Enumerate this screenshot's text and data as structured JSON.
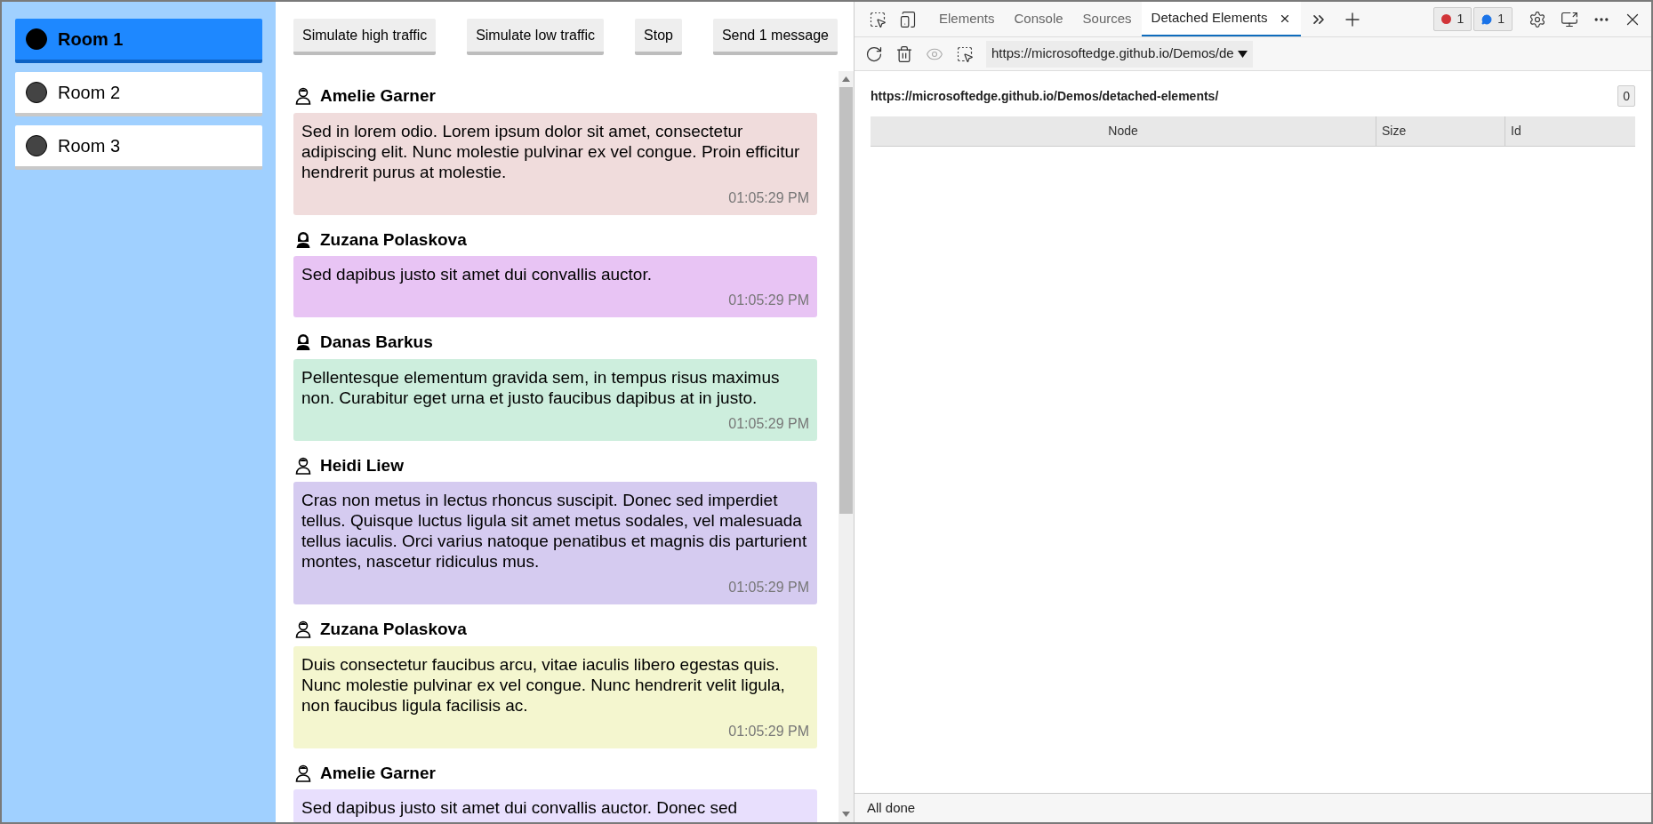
{
  "rooms": [
    {
      "label": "Room 1",
      "selected": true
    },
    {
      "label": "Room 2",
      "selected": false
    },
    {
      "label": "Room 3",
      "selected": false
    }
  ],
  "chat_buttons": [
    "Simulate high traffic",
    "Simulate low traffic",
    "Stop",
    "Send 1 message"
  ],
  "messages": [
    {
      "author": "Amelie Garner",
      "kind": "short-hair",
      "color": "#f0dcdc",
      "text": "Sed in lorem odio. Lorem ipsum dolor sit amet, consectetur adipiscing elit. Nunc molestie pulvinar ex vel congue. Proin efficitur hendrerit purus at molestie.",
      "time": "01:05:29 PM"
    },
    {
      "author": "Zuzana Polaskova",
      "kind": "long-hair",
      "color": "#e8c4f4",
      "text": "Sed dapibus justo sit amet dui convallis auctor.",
      "time": "01:05:29 PM"
    },
    {
      "author": "Danas Barkus",
      "kind": "long-hair",
      "color": "#cdeedd",
      "text": "Pellentesque elementum gravida sem, in tempus risus maximus non. Curabitur eget urna et justo faucibus dapibus at in justo.",
      "time": "01:05:29 PM"
    },
    {
      "author": "Heidi Liew",
      "kind": "short-hair",
      "color": "#d5cbf0",
      "text": "Cras non metus in lectus rhoncus suscipit. Donec sed imperdiet tellus. Quisque luctus ligula sit amet metus sodales, vel malesuada tellus iaculis. Orci varius natoque penatibus et magnis dis parturient montes, nascetur ridiculus mus.",
      "time": "01:05:29 PM"
    },
    {
      "author": "Zuzana Polaskova",
      "kind": "short-hair",
      "color": "#f4f6cf",
      "text": "Duis consectetur faucibus arcu, vitae iaculis libero egestas quis. Nunc molestie pulvinar ex vel congue. Nunc hendrerit velit ligula, non faucibus ligula facilisis ac.",
      "time": "01:05:29 PM"
    },
    {
      "author": "Amelie Garner",
      "kind": "short-hair",
      "color": "#e8dffd",
      "text": "Sed dapibus justo sit amet dui convallis auctor. Donec sed"
    }
  ],
  "devtools": {
    "tabs": [
      {
        "label": "Elements",
        "selected": false
      },
      {
        "label": "Console",
        "selected": false
      },
      {
        "label": "Sources",
        "selected": false
      },
      {
        "label": "Detached Elements",
        "selected": true
      }
    ],
    "error_count": "1",
    "message_count": "1",
    "target_url": "https://microsoftedge.github.io/Demos/de",
    "page_url": "https://microsoftedge.github.io/Demos/detached-elements/",
    "count": "0",
    "table": {
      "columns": [
        "Node",
        "Size",
        "Id"
      ]
    },
    "status": "All done"
  }
}
